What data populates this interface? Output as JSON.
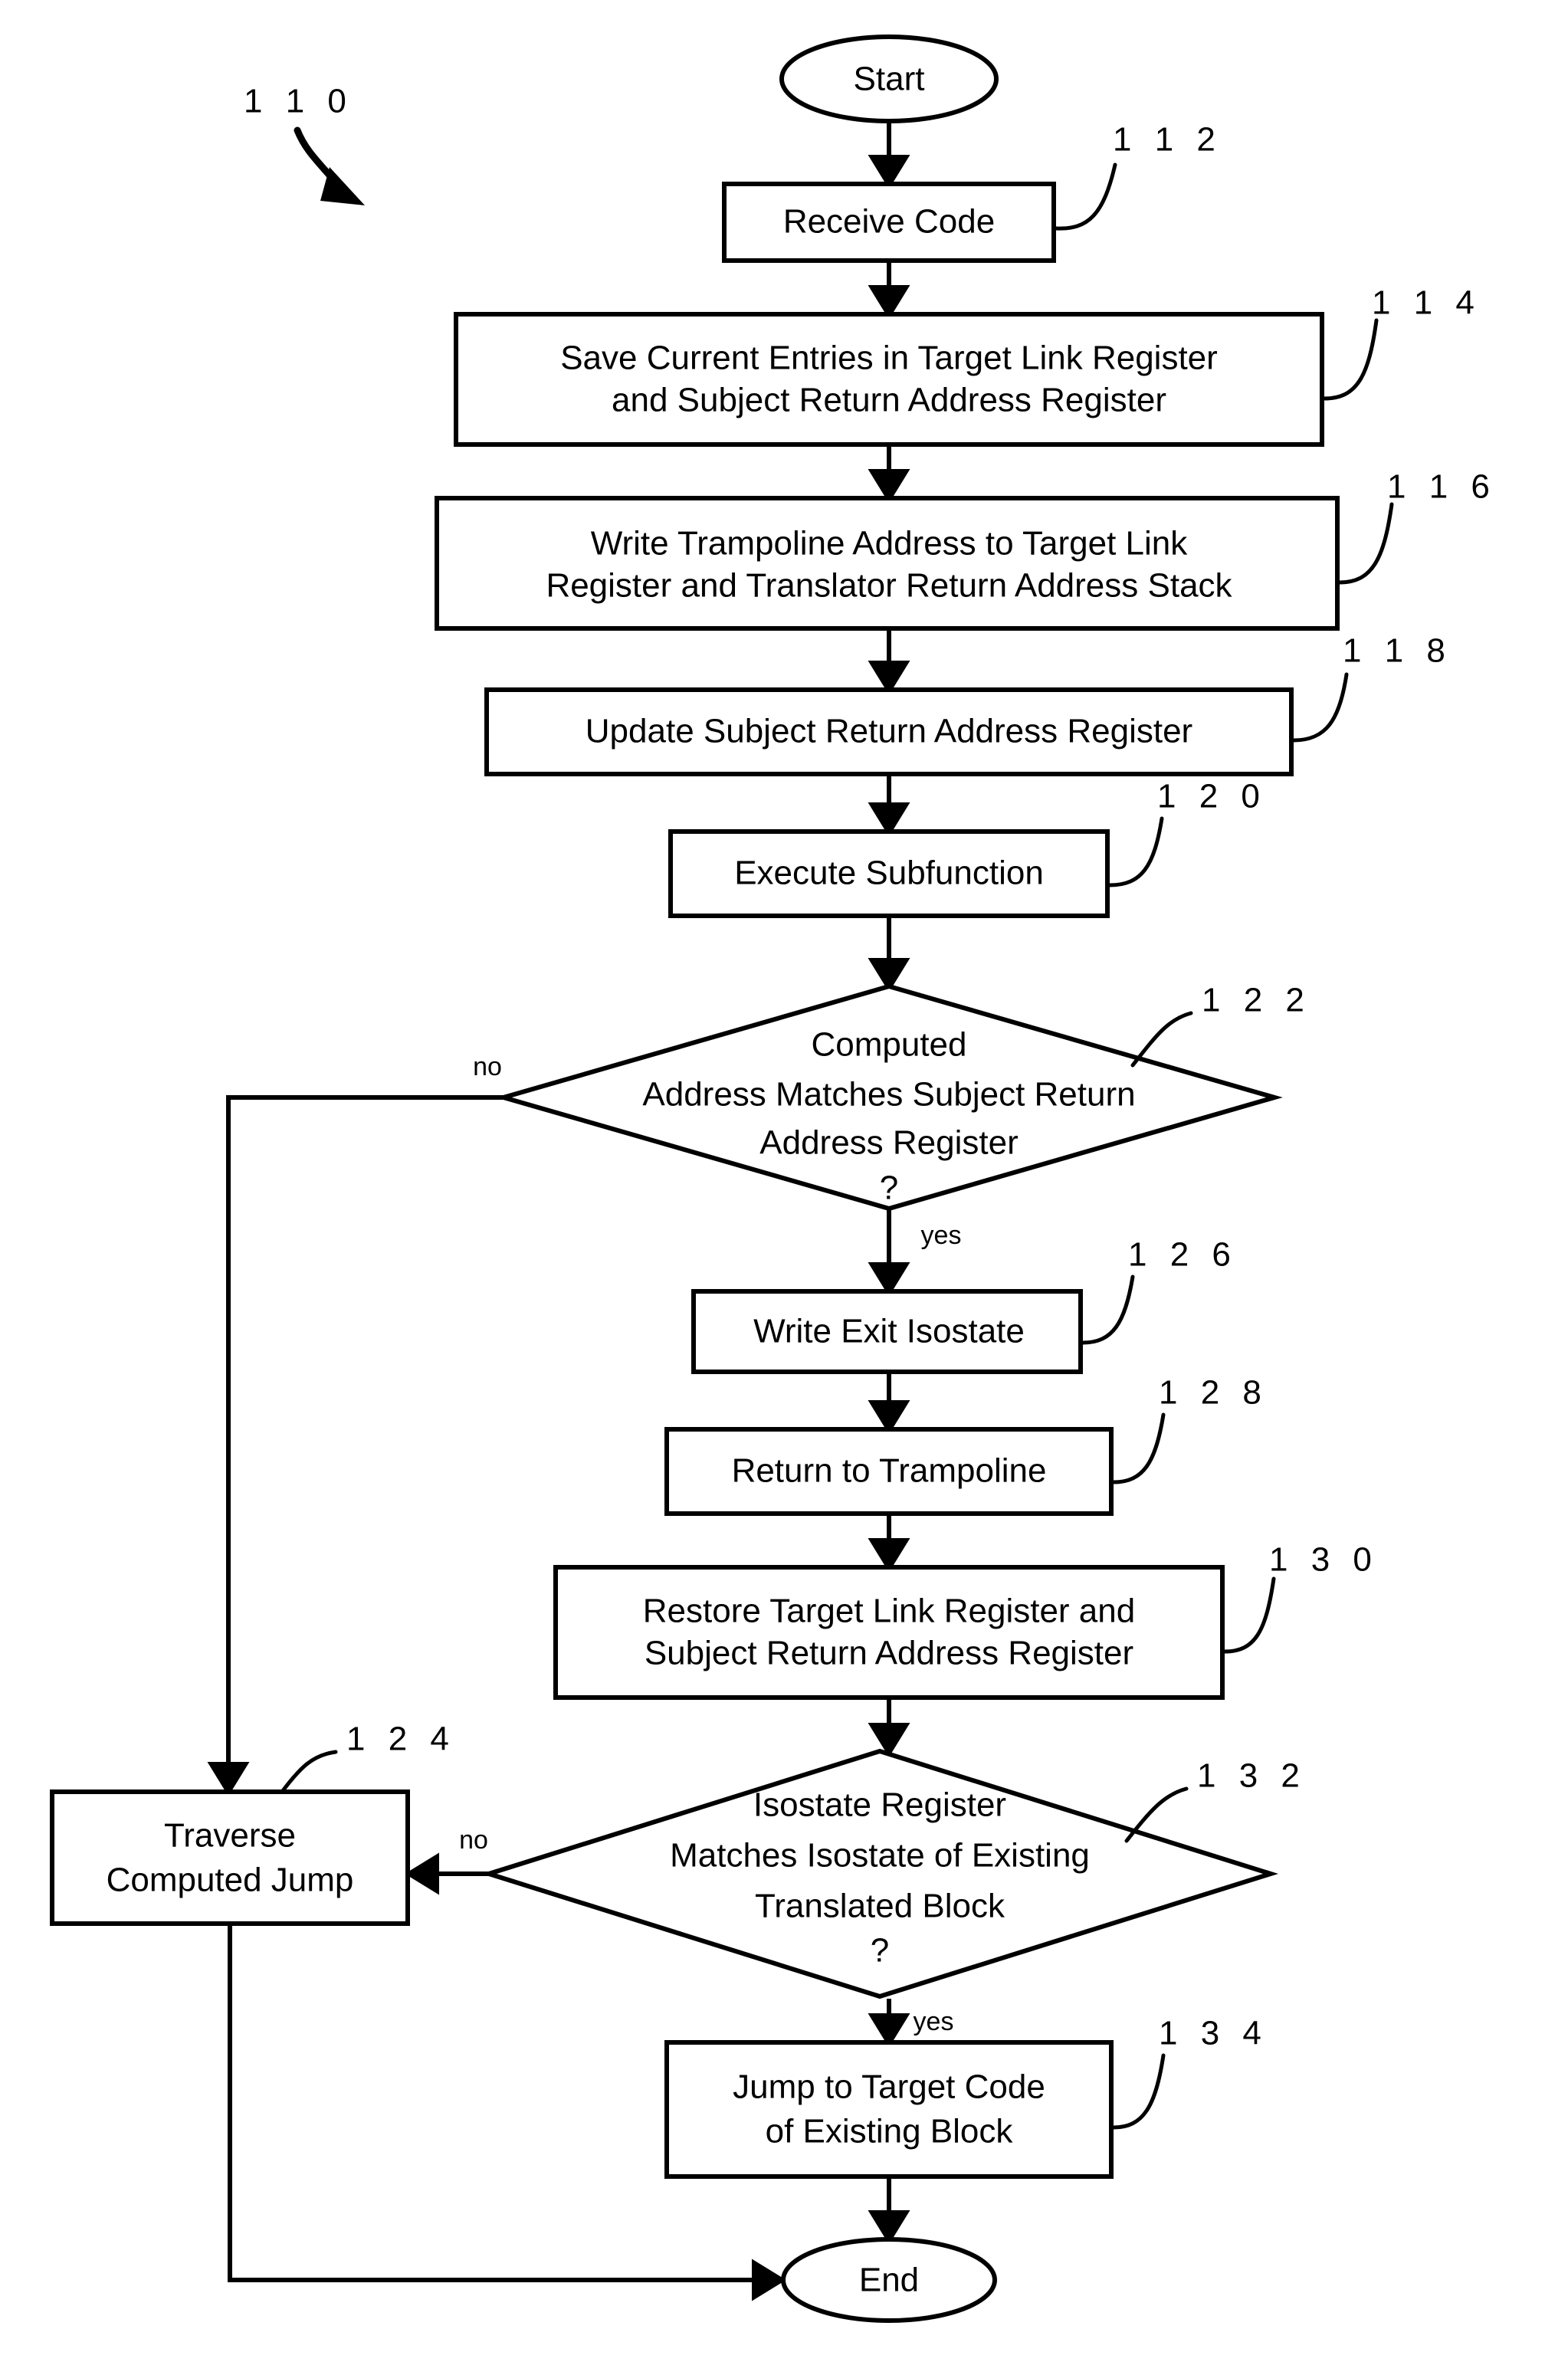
{
  "figure": {
    "reference_numeral": "1 1 0",
    "nodes": [
      {
        "id": "start",
        "ref": "",
        "shape": "ellipse",
        "lines": [
          "Start"
        ]
      },
      {
        "id": "n112",
        "ref": "1 1 2",
        "shape": "process",
        "lines": [
          "Receive Code"
        ]
      },
      {
        "id": "n114",
        "ref": "1 1 4",
        "shape": "process",
        "lines": [
          "Save Current Entries in Target Link Register",
          "and Subject Return Address Register"
        ]
      },
      {
        "id": "n116",
        "ref": "1 1 6",
        "shape": "process",
        "lines": [
          "Write Trampoline Address to Target Link",
          "Register and Translator Return Address Stack"
        ]
      },
      {
        "id": "n118",
        "ref": "1 1 8",
        "shape": "process",
        "lines": [
          "Update Subject Return Address Register"
        ]
      },
      {
        "id": "n120",
        "ref": "1 2 0",
        "shape": "process",
        "lines": [
          "Execute Subfunction"
        ]
      },
      {
        "id": "n122",
        "ref": "1 2 2",
        "shape": "decision",
        "lines": [
          "Computed",
          "Address Matches Subject Return",
          "Address Register"
        ],
        "question": "?"
      },
      {
        "id": "n126",
        "ref": "1 2 6",
        "shape": "process",
        "lines": [
          "Write Exit Isostate"
        ]
      },
      {
        "id": "n128",
        "ref": "1 2 8",
        "shape": "process",
        "lines": [
          "Return to Trampoline"
        ]
      },
      {
        "id": "n130",
        "ref": "1 3 0",
        "shape": "process",
        "lines": [
          "Restore Target Link Register and",
          "Subject Return Address Register"
        ]
      },
      {
        "id": "n132",
        "ref": "1 3 2",
        "shape": "decision",
        "lines": [
          "Isostate Register",
          "Matches Isostate of Existing",
          "Translated Block"
        ],
        "question": "?"
      },
      {
        "id": "n124",
        "ref": "1 2 4",
        "shape": "process",
        "lines": [
          "Traverse",
          "Computed Jump"
        ]
      },
      {
        "id": "n134",
        "ref": "1 3 4",
        "shape": "process",
        "lines": [
          "Jump to Target Code",
          "of Existing Block"
        ]
      },
      {
        "id": "end",
        "ref": "",
        "shape": "ellipse",
        "lines": [
          "End"
        ]
      }
    ],
    "edge_labels": {
      "d122_no": "no",
      "d122_yes": "yes",
      "d132_no": "no",
      "d132_yes": "yes"
    },
    "colors": {
      "stroke": "#000000",
      "fill": "#ffffff",
      "text": "#000000"
    }
  }
}
